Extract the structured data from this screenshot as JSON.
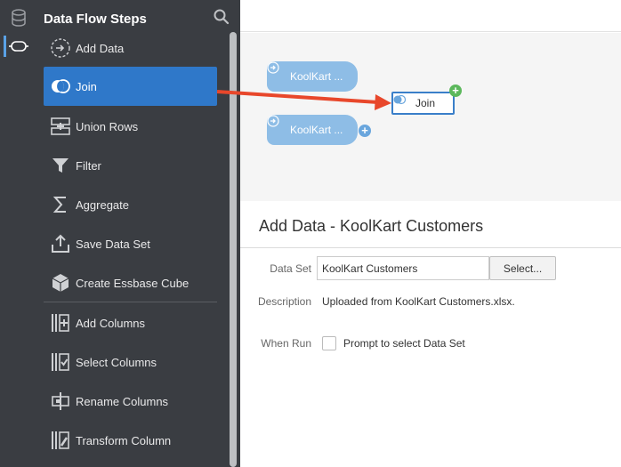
{
  "sidebar": {
    "title": "Data Flow Steps",
    "steps": [
      {
        "label": "Add Data",
        "icon": "add-data-icon"
      },
      {
        "label": "Join",
        "icon": "join-icon",
        "selected": true
      },
      {
        "label": "Union Rows",
        "icon": "union-rows-icon"
      },
      {
        "label": "Filter",
        "icon": "filter-icon"
      },
      {
        "label": "Aggregate",
        "icon": "sigma-icon"
      },
      {
        "label": "Save Data Set",
        "icon": "upload-icon"
      },
      {
        "label": "Create Essbase Cube",
        "icon": "cube-icon"
      },
      {
        "label": "Add Columns",
        "icon": "add-columns-icon"
      },
      {
        "label": "Select Columns",
        "icon": "select-columns-icon"
      },
      {
        "label": "Rename Columns",
        "icon": "rename-columns-icon"
      },
      {
        "label": "Transform Column",
        "icon": "transform-column-icon"
      }
    ]
  },
  "canvas": {
    "nodes": [
      {
        "label": "KoolKart ..."
      },
      {
        "label": "KoolKart ..."
      }
    ],
    "join_node": {
      "label": "Join"
    }
  },
  "detail": {
    "title": "Add Data - KoolKart Customers",
    "data_set_label": "Data Set",
    "data_set_value": "KoolKart Customers",
    "select_button": "Select...",
    "description_label": "Description",
    "description_value": "Uploaded from KoolKart Customers.xlsx.",
    "when_run_label": "When Run",
    "prompt_label": "Prompt to select Data Set"
  },
  "colors": {
    "sidebar_bg": "#3a3d42",
    "selected_bg": "#2f78c9",
    "node_bg": "#8ebde6",
    "arrow": "#e8472b",
    "plus_green": "#5cb85c"
  }
}
